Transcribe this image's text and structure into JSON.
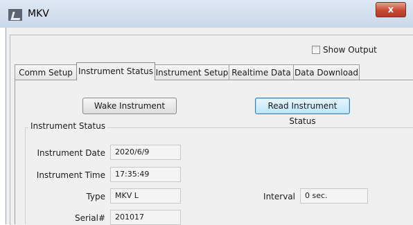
{
  "window": {
    "title": "MKV",
    "close_symbol": "x"
  },
  "show_output": {
    "label": "Show Output",
    "checked": false
  },
  "tabs": [
    {
      "label": "Comm Setup",
      "active": false
    },
    {
      "label": "Instrument Status",
      "active": true
    },
    {
      "label": "Instrument Setup",
      "active": false
    },
    {
      "label": "Realtime Data",
      "active": false
    },
    {
      "label": "Data Download",
      "active": false
    }
  ],
  "buttons": {
    "wake": "Wake Instrument",
    "read": "Read Instrument Status"
  },
  "status_group": {
    "title": "Instrument Status",
    "date_label": "Instrument Date",
    "date_value": "2020/6/9",
    "time_label": "Instrument Time",
    "time_value": "17:35:49",
    "type_label": "Type",
    "type_value": "MKV L",
    "interval_label": "Interval",
    "interval_value": "0 sec.",
    "serial_label": "Serial#",
    "serial_value": "201017"
  }
}
